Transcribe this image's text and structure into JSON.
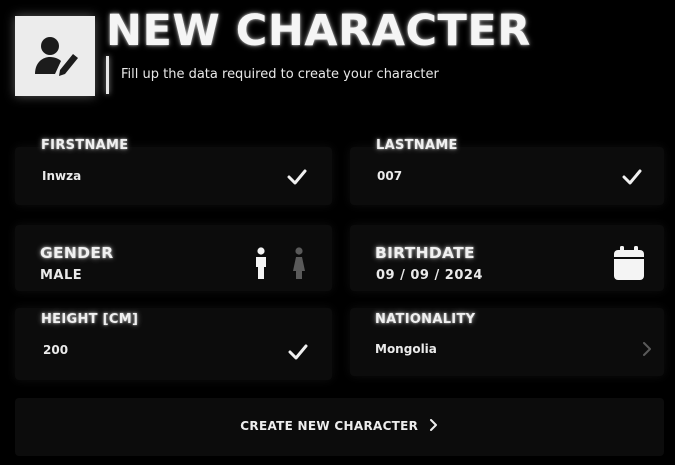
{
  "header": {
    "title": "NEW CHARACTER",
    "subtitle": "Fill up the data required to create your character",
    "icon": "user-edit-icon"
  },
  "fields": {
    "firstname": {
      "label": "FIRSTNAME",
      "value": "Inwza",
      "icon": "check-icon"
    },
    "lastname": {
      "label": "LASTNAME",
      "value": "007",
      "icon": "check-icon"
    },
    "gender": {
      "label": "GENDER",
      "value": "MALE",
      "options": [
        "male-icon",
        "female-icon"
      ],
      "selected": "male"
    },
    "birthdate": {
      "label": "BIRTHDATE",
      "value": "09 / 09 / 2024",
      "icon": "calendar-icon"
    },
    "height": {
      "label": "HEIGHT [CM]",
      "value": "200",
      "icon": "check-icon"
    },
    "nationality": {
      "label": "NATIONALITY",
      "value": "Mongolia",
      "icon": "chevron-right-icon"
    }
  },
  "actions": {
    "create_label": "CREATE NEW CHARACTER",
    "create_icon": "chevron-right-icon"
  },
  "colors": {
    "background": "#000000",
    "card": "#0c0c0c",
    "text": "#f0f0f0",
    "dim_icon": "#5a5a5a"
  }
}
